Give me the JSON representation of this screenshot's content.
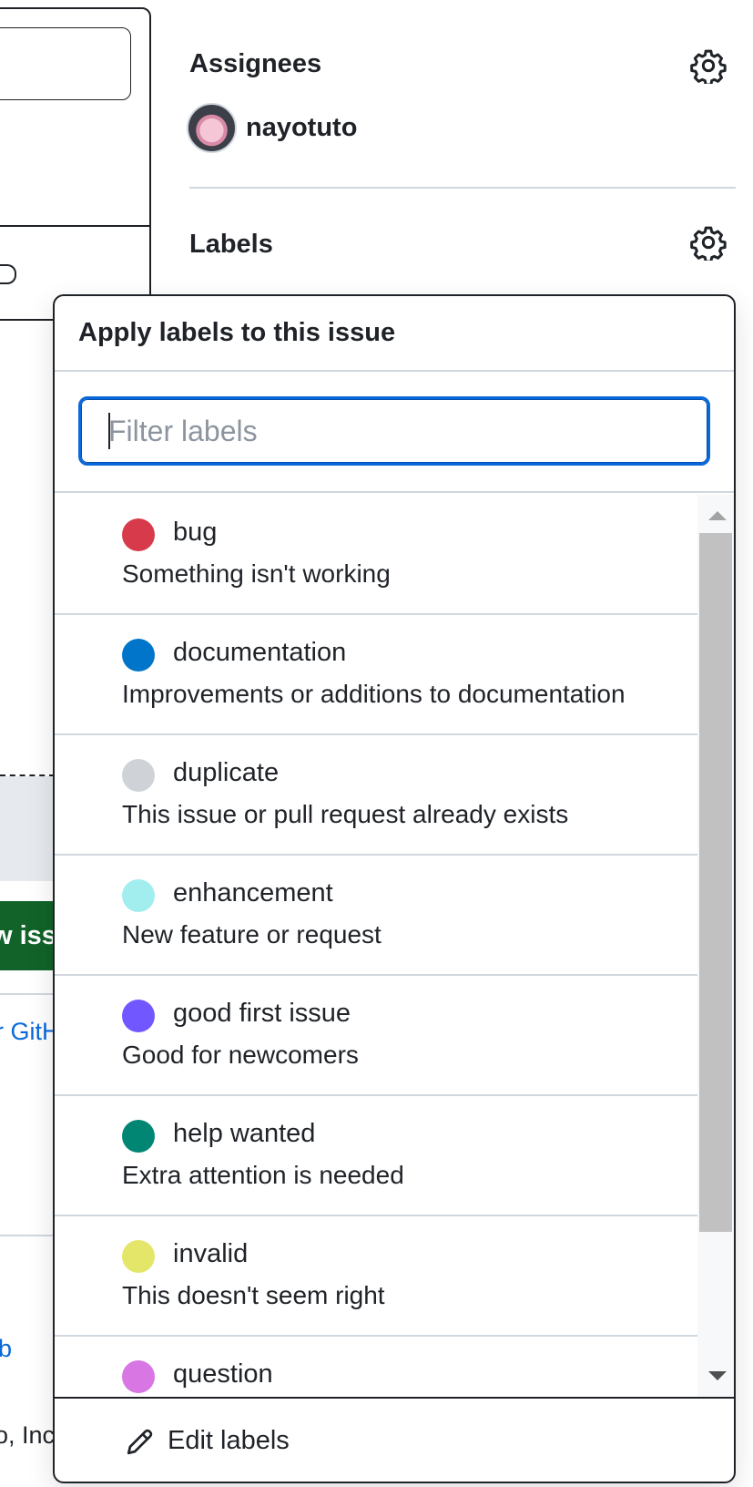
{
  "background": {
    "button_fragment": "w iss",
    "link_fragment": "r GitH",
    "link_fragment_2": "b",
    "footer_fragment": "o, Inc"
  },
  "sidebar": {
    "assignees": {
      "heading": "Assignees",
      "user": "nayotuto"
    },
    "labels": {
      "heading": "Labels"
    }
  },
  "popover": {
    "title": "Apply labels to this issue",
    "filter_placeholder": "Filter labels",
    "labels": [
      {
        "name": "bug",
        "description": "Something isn't working",
        "color": "#d73a4a"
      },
      {
        "name": "documentation",
        "description": "Improvements or additions to documentation",
        "color": "#0075ca"
      },
      {
        "name": "duplicate",
        "description": "This issue or pull request already exists",
        "color": "#cfd3d7"
      },
      {
        "name": "enhancement",
        "description": "New feature or request",
        "color": "#a2eeef"
      },
      {
        "name": "good first issue",
        "description": "Good for newcomers",
        "color": "#7057ff"
      },
      {
        "name": "help wanted",
        "description": "Extra attention is needed",
        "color": "#008672"
      },
      {
        "name": "invalid",
        "description": "This doesn't seem right",
        "color": "#e4e669"
      },
      {
        "name": "question",
        "description": "",
        "color": "#d876e3"
      }
    ],
    "edit_label": "Edit labels"
  }
}
